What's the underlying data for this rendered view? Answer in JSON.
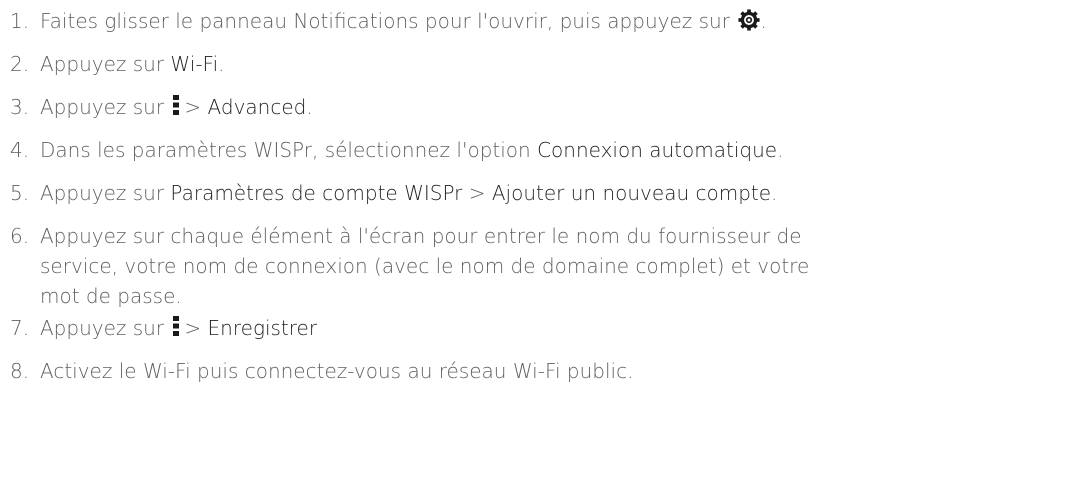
{
  "steps": [
    {
      "number": "1.",
      "text_before": "Faites glisser le panneau Notifications pour l'ouvrir, puis appuyez sur",
      "icon": "gear-icon",
      "text_after": "."
    },
    {
      "number": "2.",
      "text_before": "Appuyez sur ",
      "highlight": "Wi-Fi",
      "text_after": "."
    },
    {
      "number": "3.",
      "text_before": "Appuyez sur",
      "icon": "more-vertical-icon",
      "separator": "> ",
      "highlight": "Advanced",
      "text_after": "."
    },
    {
      "number": "4.",
      "text_before": "Dans les paramètres WISPr, sélectionnez l'option ",
      "highlight": "Connexion automatique",
      "text_after": "."
    },
    {
      "number": "5.",
      "text_before": "Appuyez sur ",
      "highlight": "Paramètres de compte WISPr",
      "separator": " > ",
      "highlight2": "Ajouter un nouveau compte",
      "text_after": "."
    },
    {
      "number": "6.",
      "lines": [
        "Appuyez sur chaque élément à l'écran pour entrer le nom du fournisseur de",
        "service, votre nom de connexion (avec le nom de domaine complet) et votre",
        "mot de passe."
      ]
    },
    {
      "number": "7.",
      "text_before": "Appuyez sur",
      "icon": "more-vertical-icon",
      "separator": "> ",
      "highlight": "Enregistrer"
    },
    {
      "number": "8.",
      "text": "Activez le Wi-Fi puis connectez-vous au réseau Wi-Fi public."
    }
  ]
}
